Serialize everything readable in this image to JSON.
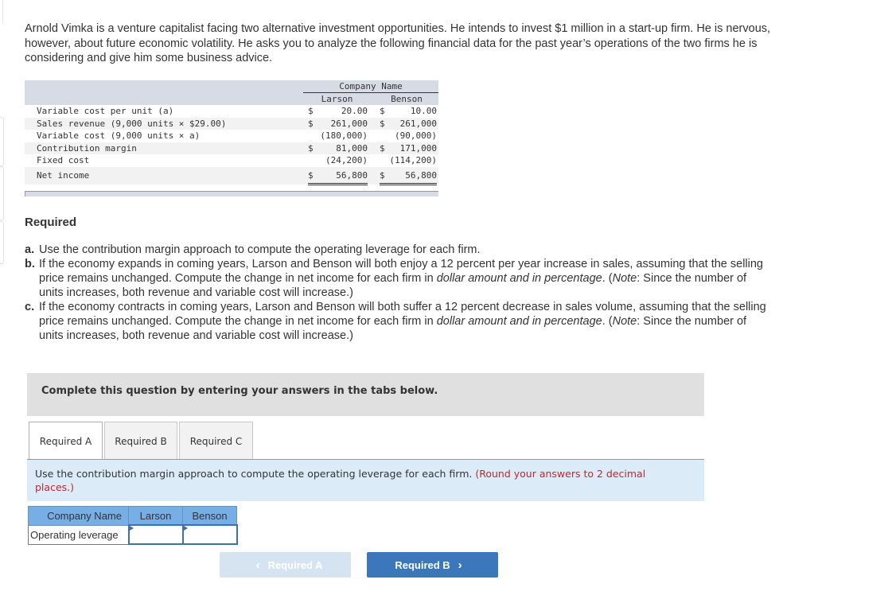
{
  "intro": "Arnold Vimka is a venture capitalist facing two alternative investment opportunities. He intends to invest $1 million in a start-up firm. He is nervous, however, about future economic volatility. He asks you to analyze the following financial data for the past year’s operations of the two firms he is considering and give him some business advice.",
  "financial_table": {
    "group_header": "Company Name",
    "columns": [
      "Larson",
      "Benson"
    ],
    "rows": [
      {
        "label": "Variable cost per unit (a)",
        "larson": {
          "dollar": "$",
          "amount": "20.00"
        },
        "benson": {
          "dollar": "$",
          "amount": "10.00"
        }
      },
      {
        "label": "Sales revenue (9,000 units × $29.00)",
        "larson": {
          "dollar": "$",
          "amount": "261,000"
        },
        "benson": {
          "dollar": "$",
          "amount": "261,000"
        }
      },
      {
        "label": "Variable cost (9,000 units × a)",
        "larson": {
          "dollar": "",
          "amount": "(180,000)"
        },
        "benson": {
          "dollar": "",
          "amount": "(90,000)"
        }
      },
      {
        "label": "Contribution margin",
        "larson": {
          "dollar": "$",
          "amount": "81,000"
        },
        "benson": {
          "dollar": "$",
          "amount": "171,000"
        }
      },
      {
        "label": "Fixed cost",
        "larson": {
          "dollar": "",
          "amount": "(24,200)"
        },
        "benson": {
          "dollar": "",
          "amount": "(114,200)"
        }
      },
      {
        "label": "Net income",
        "larson": {
          "dollar": "$",
          "amount": "56,800"
        },
        "benson": {
          "dollar": "$",
          "amount": "56,800"
        }
      }
    ]
  },
  "required": {
    "title": "Required",
    "items": [
      {
        "letter": "a.",
        "text": "Use the contribution margin approach to compute the operating leverage for each firm."
      },
      {
        "letter": "b.",
        "text_before": "If the economy expands in coming years, Larson and Benson will both enjoy a 12 percent per year increase in sales, assuming that the selling price remains unchanged. Compute the change in net income for each firm in ",
        "emphasis": "dollar amount and in percentage",
        "text_mid": ". (",
        "note": "Note",
        "text_after": ": Since the number of units increases, both revenue and variable cost will increase.)"
      },
      {
        "letter": "c.",
        "text_before": "If the economy contracts in coming years, Larson and Benson will both suffer a 12 percent decrease in sales volume, assuming that the selling price remains unchanged. Compute the change in net income for each firm in ",
        "emphasis": "dollar amount and in percentage",
        "text_mid": ". (",
        "note": "Note",
        "text_after": ": Since the number of units increases, both revenue and variable cost will increase.)"
      }
    ]
  },
  "instruction_banner": "Complete this question by entering your answers in the tabs below.",
  "tabs": [
    {
      "label": "Required A",
      "active": true
    },
    {
      "label": "Required B",
      "active": false
    },
    {
      "label": "Required C",
      "active": false
    }
  ],
  "prompt": {
    "text": "Use the contribution margin approach to compute the operating leverage for each firm.",
    "hint": "(Round your answers to 2 decimal places.)"
  },
  "answer_table": {
    "header": [
      "Company Name",
      "Larson",
      "Benson"
    ],
    "row_label": "Operating leverage",
    "values": {
      "larson": "",
      "benson": ""
    }
  },
  "nav": {
    "prev_label": "Required A",
    "next_label": "Required B",
    "prev_icon": "chevron-left-icon",
    "next_icon": "chevron-right-icon"
  }
}
